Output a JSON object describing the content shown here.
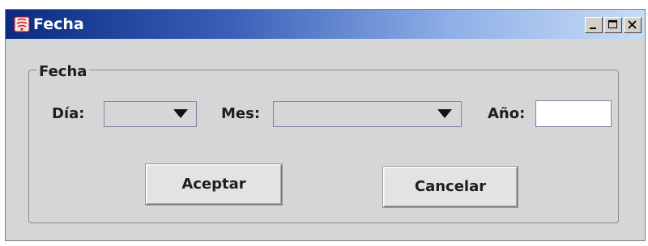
{
  "window": {
    "title": "Fecha",
    "icon": "java-app-icon",
    "controls": [
      "minimize",
      "maximize",
      "close"
    ]
  },
  "form": {
    "legend": "Fecha",
    "day": {
      "label": "Día:",
      "selected": ""
    },
    "month": {
      "label": "Mes:",
      "selected": ""
    },
    "year": {
      "label": "Año:",
      "value": ""
    }
  },
  "buttons": {
    "accept": "Aceptar",
    "cancel": "Cancelar"
  },
  "colors": {
    "window_bg": "#d6d6d6",
    "titlebar_start": "#0a2a80",
    "titlebar_end": "#c9dcf6",
    "field_border": "#7a86a8"
  }
}
